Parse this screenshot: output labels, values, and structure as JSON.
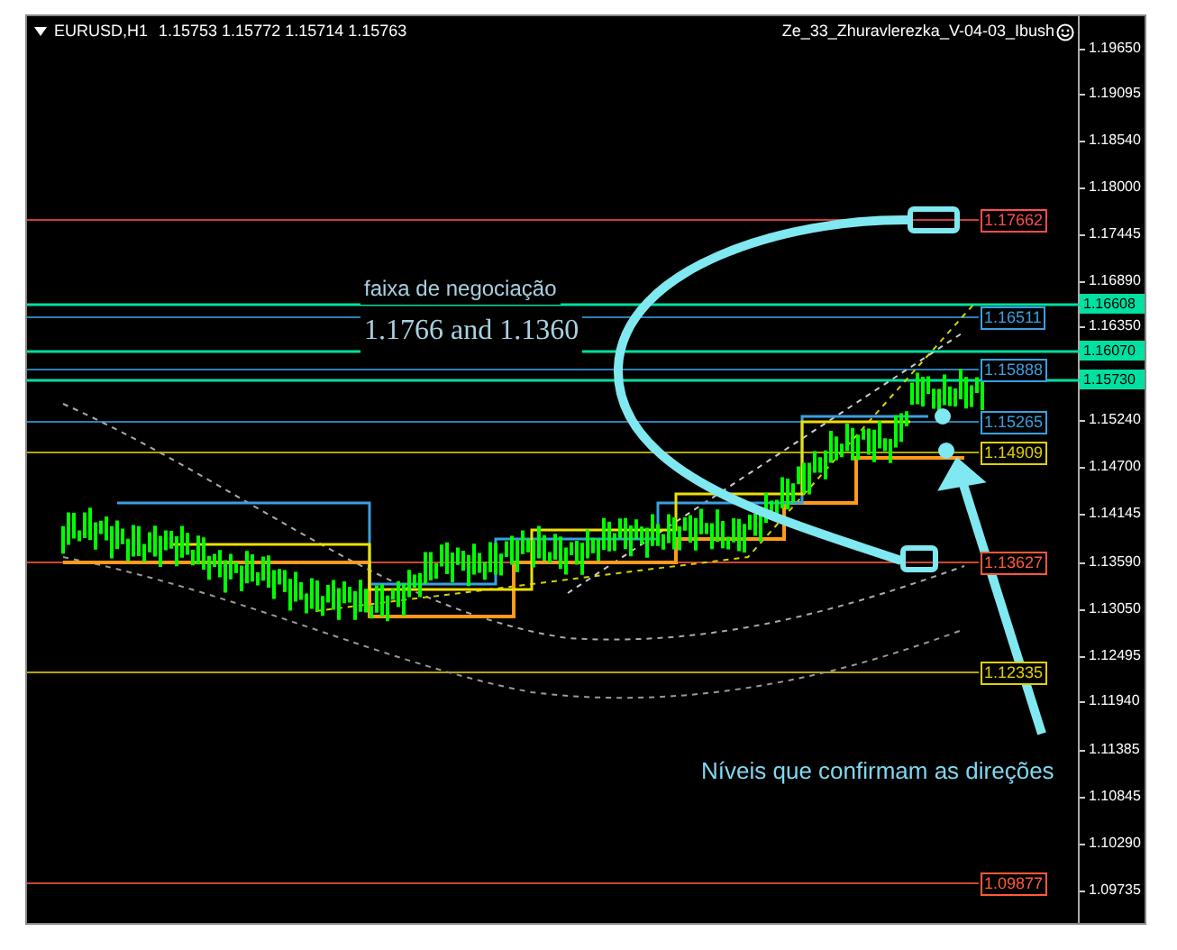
{
  "chart": {
    "title": "EURUSD,H1",
    "quote": "1.15753 1.15772 1.15714 1.15763",
    "indicator": "Ze_33_Zhuravlerezka_V-04-03_Ibush",
    "levels": [
      {
        "label": "1.17662",
        "color": "#ff4d4d"
      },
      {
        "label": "1.16511",
        "color": "#3aa0e0"
      },
      {
        "label": "1.15888",
        "color": "#3aa0e0"
      },
      {
        "label": "1.15265",
        "color": "#3aa0e0"
      },
      {
        "label": "1.14909",
        "color": "#e0d000"
      },
      {
        "label": "1.13627",
        "color": "#ff5a3a"
      },
      {
        "label": "1.12335",
        "color": "#e0d000"
      },
      {
        "label": "1.09877",
        "color": "#ff5a3a"
      }
    ],
    "annotations": [
      {
        "kind": "sans",
        "text": "faixa de negociação"
      },
      {
        "kind": "serif",
        "text": "1.1766 and 1.1360"
      },
      {
        "kind": "sans",
        "text": "Níveis que confirmam as direções"
      }
    ]
  },
  "price_axis": {
    "ticks": [
      "1.19650",
      "1.19095",
      "1.18540",
      "1.18000",
      "1.17445",
      "1.16890",
      "1.16350",
      "1.15240",
      "1.14700",
      "1.14145",
      "1.13590",
      "1.13050",
      "1.12495",
      "1.11940",
      "1.11385",
      "1.10845",
      "1.10290",
      "1.09735"
    ],
    "markers": [
      {
        "label": "1.16608"
      },
      {
        "label": "1.16070"
      },
      {
        "label": "1.15730"
      }
    ]
  }
}
